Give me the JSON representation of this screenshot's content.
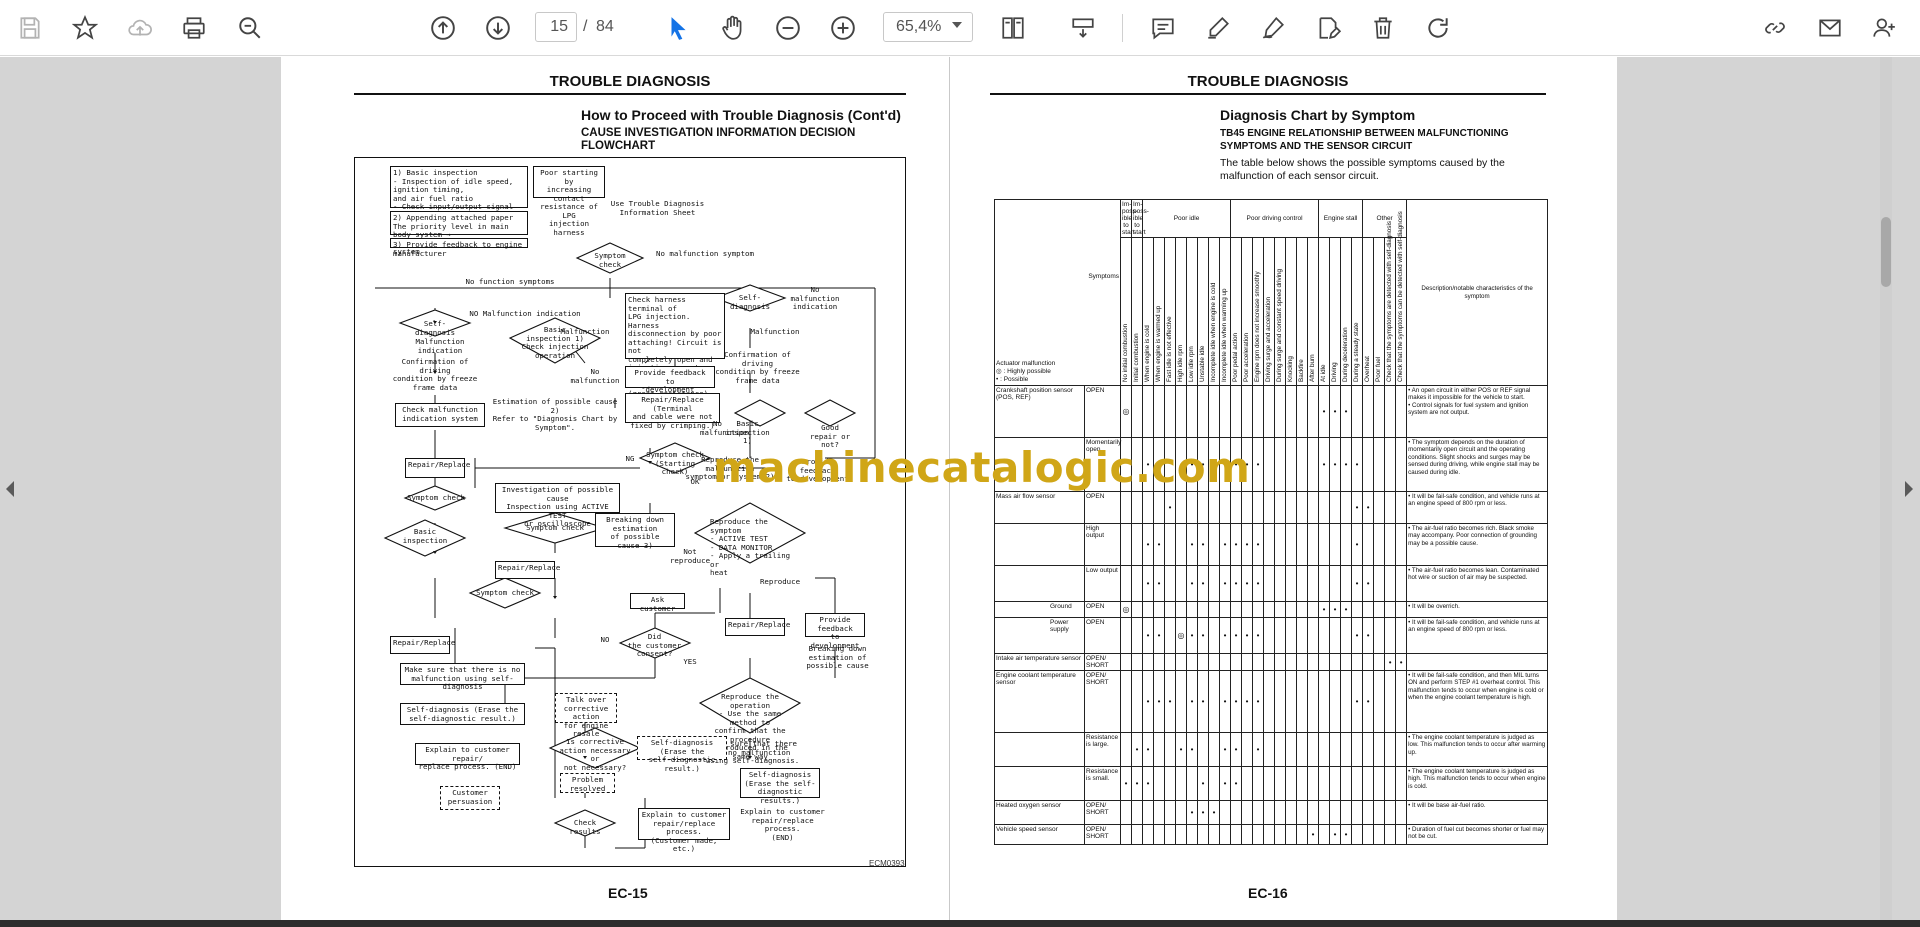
{
  "toolbar": {
    "page_current": "15",
    "page_separator": "/",
    "page_total": "84",
    "zoom_level": "65,4%",
    "icons": [
      "save-icon",
      "bookmark-star-icon",
      "cloud-upload-icon",
      "print-icon",
      "zoom-search-icon",
      "page-up-icon",
      "page-down-icon",
      "select-cursor-icon",
      "hand-icon",
      "zoom-out-icon",
      "zoom-in-icon",
      "page-layout-icon",
      "scroll-mode-icon",
      "comment-icon",
      "highlight-pen-icon",
      "signature-pen-icon",
      "edit-document-icon",
      "delete-icon",
      "rotate-icon",
      "share-link-icon",
      "mail-icon",
      "add-user-icon"
    ]
  },
  "watermark": "machinecatalogic.com",
  "left_page": {
    "header": "TROUBLE DIAGNOSIS",
    "title": "How to Proceed with Trouble Diagnosis (Cont'd)",
    "subtitle": "CAUSE INVESTIGATION INFORMATION DECISION FLOWCHART",
    "footer": "EC-15",
    "figure_id": "ECM0393",
    "flow": {
      "info_box": "1) Basic inspection\n- Inspection of idle speed, ignition timing,\n  and air fuel ratio\n- Check input/output signal\n  (Data monitor or check the voltage)",
      "append_box": "2) Appending attached paper\n  The priority level in main body system →\n  sensor system → actuator system",
      "feedback_box": "3) Provide feedback to engine manufacturer",
      "poor_start": "Poor starting by\nincreasing contact\nresistance of LPG\ninjection harness",
      "use_info": "Use Trouble Diagnosis\nInformation Sheet",
      "symptom_check": "Symptom\ncheck",
      "no_malfunction_symptom": "No malfunction symptom",
      "no_function_symptoms": "No function symptoms",
      "self_diag_1": "Self-diagnosis",
      "no_malfunction_ind": "NO Malfunction indication",
      "malfunction_ind": "Malfunction\nindication",
      "basic_insp_1": "Basic\ninspection 1)\nCheck injection\noperation",
      "malfunction": "Malfunction",
      "no_malfunction": "No malfunction",
      "check_harness": "Check harness terminal of\nLPG injection. Harness\ndisconnection by poor\nattaching! Circuit is not\ncompletely open and\ninjection is not operated\nin good condition\n(great resistance).",
      "provide_feedback_dev": "Provide feedback to\ndevelopment",
      "repair_replace_term": "Repair/Replace (Terminal\nand cable were not\nfixed by crimping.)",
      "confirm_driving": "Confirmation of driving\ncondition by freeze\nframe data",
      "check_malf_ind": "Check malfunction\nindication system",
      "estimate_cause": "Estimation of possible cause 2)\nRefer to \"Diagnosis Chart by\nSymptom\".",
      "repair_replace_1": "Repair/Replace",
      "symptom_check_2": "Symptom check\n(Starting check)",
      "ng": "NG",
      "ok": "OK",
      "investigate": "Investigation of possible cause\nInspection using ACTIVE TEST\nor oscilloscope",
      "breaking_down": "Breaking down\nestimation\nof possible cause 3)",
      "not_reproduce": "Not\nreproduce",
      "reproduce_symptom": "Reproduce the symptom\n- ACTIVE TEST\n- DATA MONITOR\n- Apply a trailing or\n  heat",
      "reproduce": "Reproduce",
      "ask_customer": "Ask customer",
      "did_customer": "Did\nthe customer\nconsent?",
      "yes": "YES",
      "no": "NO",
      "repair_replace_2": "Repair/Replace",
      "provide_feedback_2": "Provide feedback\nto development",
      "breaking_down_2": "Breaking down\nestimation of\npossible cause",
      "reproduce_op": "Reproduce the operation\n- Use the same method to\nconfirm that the procedure\nreproduced in the same way",
      "make_sure_1": "Make sure that there\nis no malfunction\nusing self-diagnosis.",
      "make_sure_2": "Make sure that there is no\nmalfunction using self-diagnosis",
      "self_diag_erase_1": "Self-diagnosis (Erase the\nself-diagnostic result.)",
      "explain_1": "Explain to customer repair/\nreplace process. (END)",
      "customer_persuasion": "Customer\npersuasion",
      "talk_over": "Talk over\ncorrective action\nfor engine resale",
      "is_corrective": "Is corrective\naction necessary or\nnot necessary?",
      "problem_solved": "Problem\nresolved",
      "check_results": "Check results",
      "self_diag_erase_2": "Self-diagnosis (Erase the\nself-diagnostic result.)",
      "explain_2": "Explain to customer\nrepair/replace process.\n(Customer made, etc.)",
      "self_diag_erase_3": "Self-diagnosis\n(Erase the self-diagnostic\nresults.)",
      "explain_3": "Explain to customer\nrepair/replace process.\n(END)",
      "basic_insp_2": "Basic\ninspection",
      "basic_insp_3": "Basic\ninspection 1)",
      "repair_replace_3": "Repair/Replace",
      "repair_replace_4": "Repair/Replace",
      "symptom_check_3": "Symptom check",
      "symptom_check_4": "Symptom check",
      "symptom_check_5": "Symptom check",
      "self_diag_2": "Self-diagnosis",
      "no_malf_ind_2": "No malfunction\nindication",
      "confirm_driving_2": "Confirmation of driving\ncondition by freeze\nframe data",
      "good_repair": "Good\nrepair or not?",
      "provide_feedback_3": "Provide feedback\nto development",
      "malfunction_2": "Malfunction",
      "no_malf_2": "No\nmalfunction",
      "reproduce_malf": "Reproduce the malfunction\nsymptom or system 2)"
    }
  },
  "right_page": {
    "header": "TROUBLE DIAGNOSIS",
    "title": "Diagnosis Chart by Symptom",
    "subtitle": "TB45 ENGINE RELATIONSHIP BETWEEN MALFUNCTIONING SYMPTOMS AND THE SENSOR CIRCUIT",
    "intro": "The table below shows the possible symptoms caused by the malfunction of each sensor circuit.",
    "footer": "EC-16",
    "table": {
      "symptoms_label": "Symptoms",
      "legend": "Actuator malfunction\n◎ : Highly possible\n• : Possible",
      "groups": [
        "Im-\nposs-\nible to\nstart",
        "Im-\nposs-\nible to\nstart",
        "Poor idle",
        "Poor driving control",
        "Engine stall",
        "Other"
      ],
      "columns": [
        "No initial combustion",
        "Initial combustion",
        "When engine is cold",
        "When engine is warmed up",
        "Fast idle is not effective",
        "High idle rpm",
        "Low idle rpm",
        "Unstable idle",
        "Incomplete idle when engine is cold",
        "Incomplete idle when warming up",
        "Poor pedal action",
        "Poor acceleration",
        "Engine rpm does not increase smoothly",
        "Driving surge and acceleration",
        "During surge and constant speed driving",
        "Knocking",
        "Backfire",
        "After burn",
        "At idle",
        "Driving",
        "During deceleration",
        "During a steady state",
        "Overheat",
        "Poor fuel",
        "Check that the symptoms are detected with self-diagnosis",
        "Check that the symptoms can be detected with self-diagnosis"
      ],
      "desc_header": "Description/notable characteristics of the symptom",
      "rows": [
        {
          "sensor": "Crankshaft position sensor (POS, REF)",
          "cond": "OPEN",
          "desc": "• An open circuit in either POS or REF signal makes it impossible for the vehicle to start.\n• Control signals for fuel system and ignition system are not output."
        },
        {
          "sensor": "",
          "cond": "Momentarily open",
          "desc": "• The symptom depends on the duration of momentarily open circuit and the operating conditions. Slight shocks and surges may be sensed during driving, while engine stall may be caused during idle."
        },
        {
          "sensor": "Mass air flow sensor",
          "cond": "OPEN",
          "desc": "• It will be fail-safe condition, and vehicle runs at an engine speed of 800 rpm or less."
        },
        {
          "sensor": "",
          "cond": "High output",
          "desc": "• The air-fuel ratio becomes rich. Black smoke may accompany. Poor connection of grounding may be a possible cause."
        },
        {
          "sensor": "",
          "cond": "Low output",
          "desc": "• The air-fuel ratio becomes lean. Contaminated hot wire or suction of air may be suspected."
        },
        {
          "sensor": "",
          "subcond": "Ground",
          "cond": "OPEN",
          "desc": "• It will be overrich."
        },
        {
          "sensor": "",
          "subcond": "Power supply",
          "cond": "OPEN",
          "desc": "• It will be fail-safe condition, and vehicle runs at an engine speed of 800 rpm or less."
        },
        {
          "sensor": "Intake air temperature sensor",
          "cond": "OPEN/ SHORT",
          "desc": ""
        },
        {
          "sensor": "Engine coolant temperature sensor",
          "cond": "OPEN/ SHORT",
          "desc": "• It will be fail-safe condition, and then MIL turns ON and perform STEP #1 overheat control. This malfunction tends to occur when engine is cold or when the engine coolant temperature is high."
        },
        {
          "sensor": "",
          "cond": "Resistance is large.",
          "desc": "• The engine coolant temperature is judged as low. This malfunction tends to occur after warming up."
        },
        {
          "sensor": "",
          "cond": "Resistance is small.",
          "desc": "• The engine coolant temperature is judged as high. This malfunction tends to occur when engine is cold."
        },
        {
          "sensor": "Heated oxygen sensor",
          "cond": "OPEN/ SHORT",
          "desc": "• It will be base air-fuel ratio."
        },
        {
          "sensor": "Vehicle speed sensor",
          "cond": "OPEN/ SHORT",
          "desc": "• Duration of fuel cut becomes shorter or fuel may not be cut."
        }
      ]
    }
  }
}
